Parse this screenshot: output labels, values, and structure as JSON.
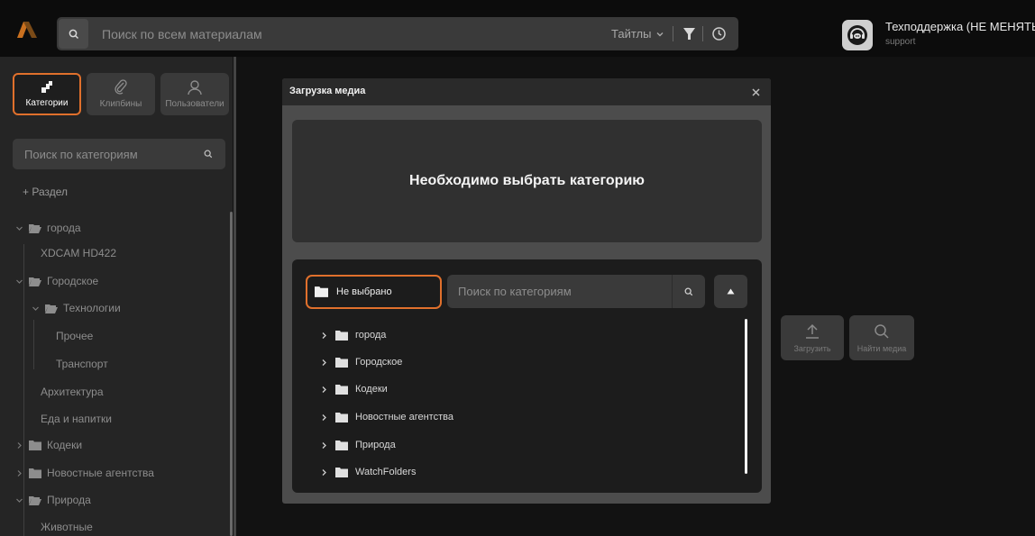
{
  "topbar": {
    "search_placeholder": "Поиск по всем материалам",
    "scope_label": "Тайтлы",
    "user": {
      "name": "Техподдержка (НЕ МЕНЯТЬ)",
      "login": "support"
    }
  },
  "sidebar": {
    "tabs": [
      {
        "label": "Категории",
        "active": true,
        "icon": "categories-icon"
      },
      {
        "label": "Клипбины",
        "active": false,
        "icon": "paperclip-icon"
      },
      {
        "label": "Пользователи",
        "active": false,
        "icon": "user-icon"
      }
    ],
    "search_placeholder": "Поиск по категориям",
    "add_section": "+ Раздел",
    "tree": [
      {
        "label": "города",
        "expanded": true,
        "folder": true,
        "level": 0
      },
      {
        "label": "XDCAM HD422",
        "folder": false,
        "level": 1
      },
      {
        "label": "Городское",
        "expanded": true,
        "folder": true,
        "level": 0
      },
      {
        "label": "Технологии",
        "expanded": true,
        "folder": true,
        "level": 1
      },
      {
        "label": "Прочее",
        "folder": false,
        "level": 2
      },
      {
        "label": "Транспорт",
        "folder": false,
        "level": 2
      },
      {
        "label": "Архитектура",
        "folder": false,
        "level": 1
      },
      {
        "label": "Еда и напитки",
        "folder": false,
        "level": 1
      },
      {
        "label": "Кодеки",
        "expanded": false,
        "folder": true,
        "level": 0
      },
      {
        "label": "Новостные агентства",
        "expanded": false,
        "folder": true,
        "level": 0
      },
      {
        "label": "Природа",
        "expanded": true,
        "folder": true,
        "level": 0
      },
      {
        "label": "Животные",
        "folder": false,
        "level": 1
      }
    ]
  },
  "actions": {
    "upload_label": "Загрузить",
    "find_label": "Найти медиа"
  },
  "modal": {
    "title": "Загрузка медиа",
    "notice": "Необходимо выбрать категорию",
    "selected_category": "Не выбрано",
    "search_placeholder": "Поиск по категориям",
    "categories": [
      "города",
      "Городское",
      "Кодеки",
      "Новостные агентства",
      "Природа",
      "WatchFolders"
    ]
  },
  "colors": {
    "accent": "#e0702c",
    "background": "#121212",
    "panel": "#252525",
    "modal": "#4c4c4c"
  }
}
